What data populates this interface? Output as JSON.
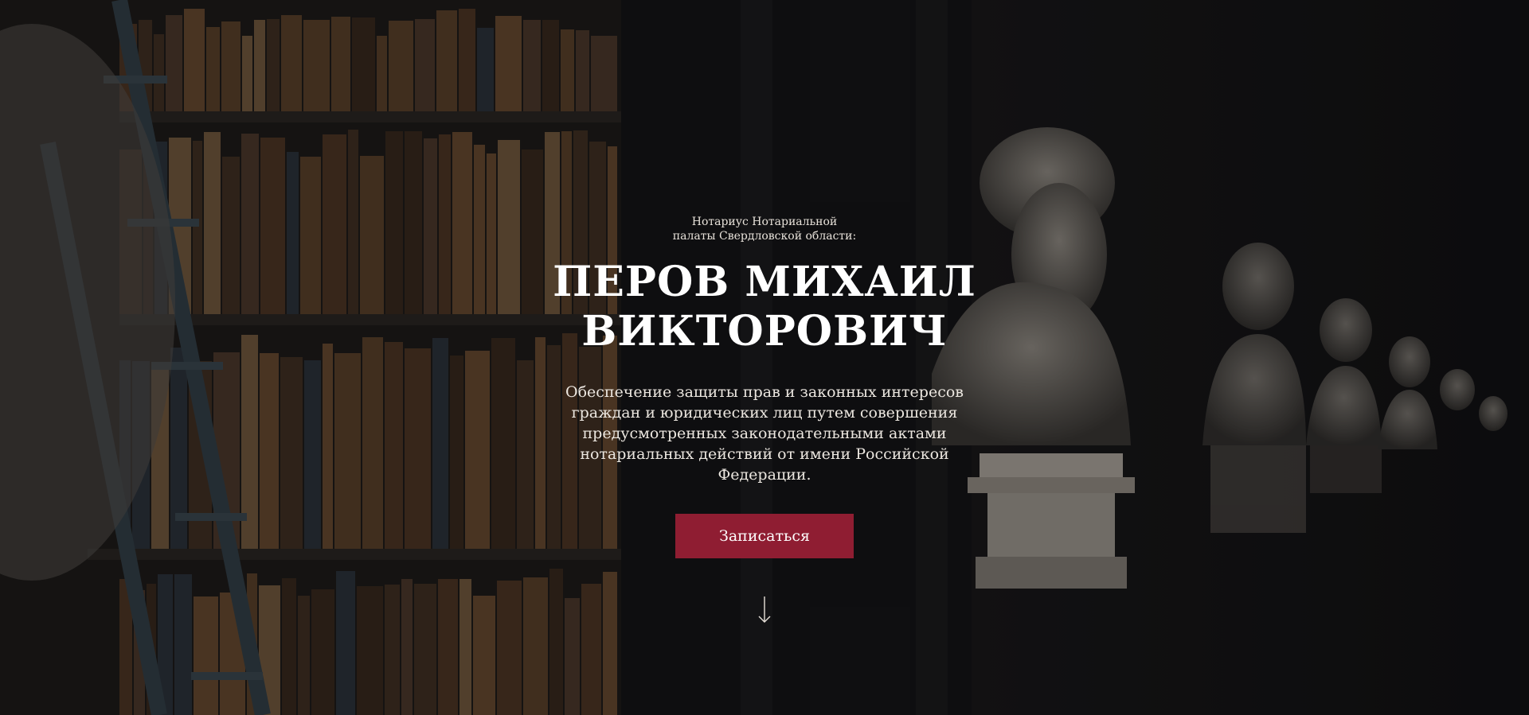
{
  "hero": {
    "eyebrow": "Нотариус Нотариальной палаты Свердловской области:",
    "title_line1": "ПЕРОВ МИХАИЛ",
    "title_line2": "ВИКТОРОВИЧ",
    "description": "Обеспечение защиты прав и законных интересов граждан и юридических лиц путем совершения предусмотренных законодательными актами нотариальных действий от имени Российской Федерации.",
    "cta_label": "Записаться",
    "scroll_icon": "arrow-down-icon"
  },
  "colors": {
    "accent": "#8f1d32",
    "background": "#111111",
    "text": "#ffffff"
  }
}
